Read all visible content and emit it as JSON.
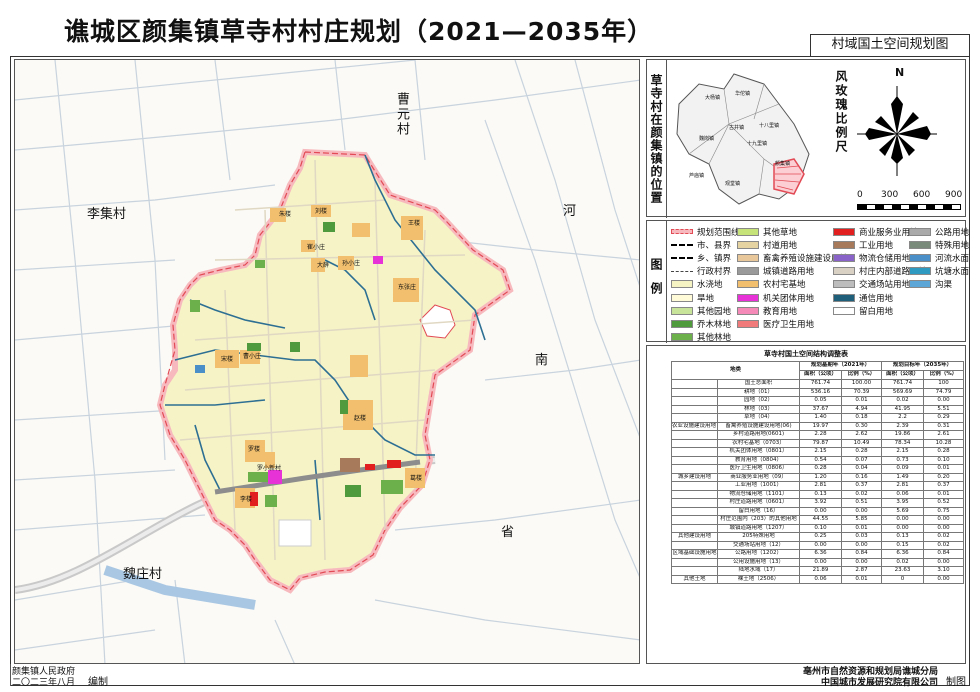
{
  "title": "谯城区颜集镇草寺村村庄规划（2021—2035年）",
  "subtitle": "村域国土空间规划图",
  "map": {
    "places": {
      "caoyuan": "曹元村",
      "lijicun": "李集村",
      "weizhuang": "魏庄村",
      "nan": "南",
      "he": "河",
      "sheng": "省"
    },
    "labels": [
      "朱楼",
      "刘楼",
      "王楼",
      "崔小庄",
      "大薛",
      "孙小庄",
      "东张庄",
      "宋楼",
      "曹小庄",
      "赵楼",
      "罗楼",
      "罗小新村",
      "李楼",
      "葛楼"
    ]
  },
  "location": {
    "title": "草寺村在颜集镇的位置",
    "towns": [
      "大杨镇",
      "华佗镇",
      "魏岗镇",
      "颜集镇",
      "古井镇",
      "十八里镇",
      "十九里镇",
      "芦庙镇",
      "观堂镇"
    ]
  },
  "compass": {
    "north": "N",
    "scale_title": "风玫瑰比例尺",
    "scale_ticks": [
      "0",
      "300",
      "600",
      "900"
    ]
  },
  "legend": {
    "title": "图例",
    "columns": [
      [
        {
          "label": "规划范围线",
          "color": "#f7b9bd",
          "kind": "line-red"
        },
        {
          "label": "市、县界",
          "color": "#000000",
          "kind": "line"
        },
        {
          "label": "乡、镇界",
          "color": "#000000",
          "kind": "line"
        },
        {
          "label": "行政村界",
          "color": "#444444",
          "kind": "line-dot"
        },
        {
          "label": "水浇地",
          "color": "#f5f3c4",
          "kind": "fill"
        },
        {
          "label": "旱地",
          "color": "#fffbd8",
          "kind": "fill"
        },
        {
          "label": "其他园地",
          "color": "#c8e39a",
          "kind": "fill"
        },
        {
          "label": "乔木林地",
          "color": "#4f9a3c",
          "kind": "fill"
        },
        {
          "label": "其他林地",
          "color": "#6bb04a",
          "kind": "fill"
        }
      ],
      [
        {
          "label": "其他草地",
          "color": "#c6e37a",
          "kind": "fill"
        },
        {
          "label": "村道用地",
          "color": "#e5d3a1",
          "kind": "fill"
        },
        {
          "label": "畜禽养殖设施建设用地",
          "color": "#e8c89a",
          "kind": "fill"
        },
        {
          "label": "城镇道路用地",
          "color": "#9a9a9a",
          "kind": "fill"
        },
        {
          "label": "农村宅基地",
          "color": "#f1bf6d",
          "kind": "fill"
        },
        {
          "label": "机关团体用地",
          "color": "#e632d6",
          "kind": "fill"
        },
        {
          "label": "教育用地",
          "color": "#f58ab8",
          "kind": "fill"
        },
        {
          "label": "医疗卫生用地",
          "color": "#f07a7a",
          "kind": "fill"
        }
      ],
      [
        {
          "label": "商业服务业用地",
          "color": "#e21f1f",
          "kind": "fill"
        },
        {
          "label": "工业用地",
          "color": "#a87a5c",
          "kind": "fill"
        },
        {
          "label": "物流仓储用地",
          "color": "#8a63c9",
          "kind": "fill"
        },
        {
          "label": "村庄内部道路用地",
          "color": "#d9d2c4",
          "kind": "fill"
        },
        {
          "label": "交通场站用地",
          "color": "#bdbdbd",
          "kind": "fill"
        },
        {
          "label": "通信用地",
          "color": "#1f5f7a",
          "kind": "fill"
        },
        {
          "label": "留白用地",
          "color": "#ffffff",
          "kind": "fill"
        }
      ],
      [
        {
          "label": "公路用地",
          "color": "#aaaaaa",
          "kind": "fill"
        },
        {
          "label": "特殊用地",
          "color": "#7a8a7a",
          "kind": "fill"
        },
        {
          "label": "河流水面",
          "color": "#4b8fc9",
          "kind": "fill"
        },
        {
          "label": "坑塘水面",
          "color": "#2f9ac1",
          "kind": "fill"
        },
        {
          "label": "沟渠",
          "color": "#5ba6d6",
          "kind": "fill"
        }
      ]
    ]
  },
  "table": {
    "title": "草寺村国土空间结构调整表",
    "head": {
      "category": "地类",
      "base": "规划基期年（2021年）",
      "target": "规划目标年（2035年）",
      "area": "面积（公顷）",
      "ratio": "比例（%）"
    },
    "rows": [
      [
        "",
        "国土总面积",
        "761.74",
        "100.00",
        "761.74",
        "100"
      ],
      [
        "",
        "耕地（01）",
        "536.16",
        "70.39",
        "569.69",
        "74.79"
      ],
      [
        "",
        "园地（02）",
        "0.05",
        "0.01",
        "0.02",
        "0.00"
      ],
      [
        "",
        "林地（03）",
        "37.67",
        "4.94",
        "41.95",
        "5.51"
      ],
      [
        "",
        "草地（04）",
        "1.40",
        "0.18",
        "2.2",
        "0.29"
      ],
      [
        "农业设施建设用地（06）",
        "畜禽养殖设施建设用地(06)",
        "19.97",
        "0.30",
        "2.39",
        "0.31"
      ],
      [
        "",
        "乡村道路用地(0601)",
        "2.28",
        "2.62",
        "19.86",
        "2.61"
      ],
      [
        "",
        "农村宅基地（0703）",
        "79.87",
        "10.49",
        "78.34",
        "10.28"
      ],
      [
        "",
        "机关团体用地（0801）",
        "2.15",
        "0.28",
        "2.15",
        "0.28"
      ],
      [
        "",
        "教育用地（0804）",
        "0.54",
        "0.07",
        "0.73",
        "0.10"
      ],
      [
        "",
        "医疗卫生用地（0806）",
        "0.28",
        "0.04",
        "0.09",
        "0.01"
      ],
      [
        "城乡建设用地",
        "商业服务业用地（09）",
        "1.20",
        "0.16",
        "1.49",
        "0.20"
      ],
      [
        "",
        "工业用地（1001）",
        "2.81",
        "0.37",
        "2.81",
        "0.37"
      ],
      [
        "",
        "物流仓储用地（1101）",
        "0.13",
        "0.02",
        "0.06",
        "0.01"
      ],
      [
        "",
        "村庄道路用地（0601）",
        "3.92",
        "0.51",
        "3.95",
        "0.52"
      ],
      [
        "",
        "留白用地（16）",
        "0.00",
        "0.00",
        "5.69",
        "0.75"
      ],
      [
        "",
        "村庄范围内（203）的其他用地",
        "44.55",
        "5.85",
        "0.00",
        "0.00"
      ],
      [
        "",
        "城镇道路用地（1207）",
        "0.10",
        "0.01",
        "0.00",
        "0.00"
      ],
      [
        "其他建设用地",
        "205特殊用地",
        "0.25",
        "0.03",
        "0.13",
        "0.02"
      ],
      [
        "",
        "交通场站用地（12）",
        "0.00",
        "0.00",
        "0.15",
        "0.02"
      ],
      [
        "区域基础设施用地",
        "公路用地（1202）",
        "6.36",
        "0.84",
        "6.36",
        "0.84"
      ],
      [
        "",
        "公用设施用地（13）",
        "0.00",
        "0.00",
        "0.02",
        "0.00"
      ],
      [
        "",
        "陆地水域（17）",
        "21.89",
        "2.87",
        "23.63",
        "3.10"
      ],
      [
        "其他土地",
        "裸土地（2506）",
        "0.06",
        "0.01",
        "0",
        "0.00"
      ]
    ]
  },
  "footer": {
    "gov": "颜集镇人民政府",
    "date": "二〇二三年八月",
    "edit": "编制",
    "org1": "亳州市自然资源和规划局谯城分局",
    "org2": "中国城市发展研究院有限公司",
    "make": "制图"
  }
}
